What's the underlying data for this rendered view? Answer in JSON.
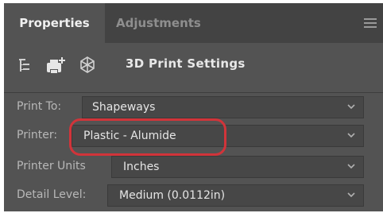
{
  "tabs": [
    {
      "label": "Properties",
      "active": true
    },
    {
      "label": "Adjustments",
      "active": false
    }
  ],
  "toolbar": {
    "icons": [
      "layer-tree-icon",
      "print-add-icon",
      "3d-scene-icon"
    ],
    "title": "3D Print Settings"
  },
  "fields": [
    {
      "label": "Print To:",
      "value": "Shapeways"
    },
    {
      "label": "Printer:",
      "value": "Plastic - Alumide"
    },
    {
      "label": "Printer Units",
      "value": "Inches"
    },
    {
      "label": "Detail Level:",
      "value": "Medium (0.0112in)"
    }
  ],
  "colors": {
    "panel": "#535353",
    "tabbar": "#434343",
    "highlight": "#d1343a"
  }
}
